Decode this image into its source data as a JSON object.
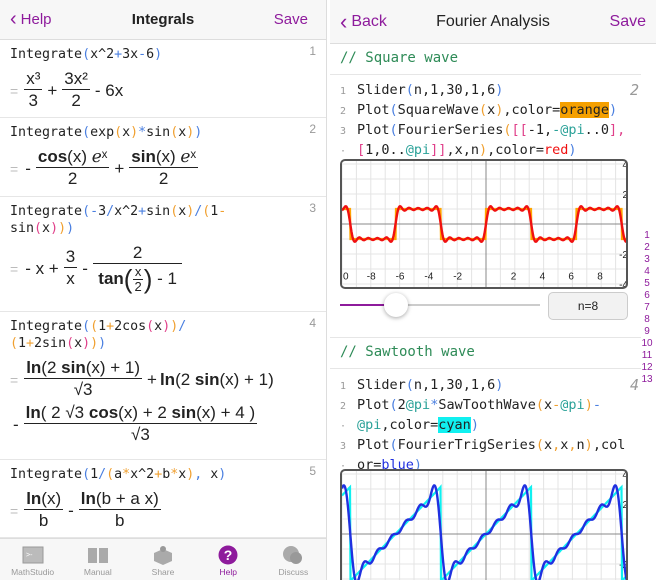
{
  "left": {
    "header": {
      "back": "Help",
      "title": "Integrals",
      "save": "Save"
    },
    "cells": [
      {
        "num": "1",
        "code": [
          [
            "Integrate",
            ""
          ],
          [
            "(",
            "b"
          ],
          [
            "x^2",
            ""
          ],
          [
            "+",
            "b"
          ],
          [
            "3x",
            ""
          ],
          [
            "-",
            "b"
          ],
          [
            "6",
            ""
          ],
          [
            ")",
            "b"
          ]
        ],
        "r": {
          "n1": "x³",
          "d1": "3",
          "op1": "+",
          "n2": "3x²",
          "d2": "2",
          "tail": "- 6x"
        }
      },
      {
        "num": "2",
        "code": [
          [
            "Integrate",
            ""
          ],
          [
            "(",
            "b"
          ],
          [
            "exp",
            ""
          ],
          [
            "(",
            "o"
          ],
          [
            "x",
            ""
          ],
          [
            ")",
            "o"
          ],
          [
            "*",
            "b"
          ],
          [
            "sin",
            ""
          ],
          [
            "(",
            "o"
          ],
          [
            "x",
            ""
          ],
          [
            ")",
            "o"
          ],
          [
            ")",
            "b"
          ]
        ],
        "r": {
          "op0": "-",
          "n1": "cos(x) ℯˣ",
          "d1": "2",
          "op1": "+",
          "n2": "sin(x) ℯˣ",
          "d2": "2"
        }
      },
      {
        "num": "3",
        "code": [
          [
            "Integrate",
            ""
          ],
          [
            "(",
            "b"
          ],
          [
            "-",
            "b"
          ],
          [
            "3",
            ""
          ],
          [
            "/",
            "b"
          ],
          [
            "x^2",
            ""
          ],
          [
            "+",
            "b"
          ],
          [
            "sin",
            ""
          ],
          [
            "(",
            "o"
          ],
          [
            "x",
            ""
          ],
          [
            ")",
            "o"
          ],
          [
            "/",
            "b"
          ],
          [
            "(",
            "o"
          ],
          [
            "1",
            ""
          ],
          [
            "-",
            "o"
          ],
          [
            "\n",
            ""
          ],
          [
            "sin",
            ""
          ],
          [
            "(",
            "p"
          ],
          [
            "x",
            ""
          ],
          [
            ")",
            "p"
          ],
          [
            ")",
            "o"
          ],
          [
            ")",
            "b"
          ]
        ],
        "r": {
          "op0": "- x +",
          "n1": "3",
          "d1": "x",
          "op1": "-",
          "n2": "2",
          "d2a": "tan",
          "lp": "(",
          "sn": "x",
          "sd": "2",
          "rp": ")",
          "d2b": "- 1"
        }
      },
      {
        "num": "4",
        "code": [
          [
            "Integrate",
            ""
          ],
          [
            "(",
            "b"
          ],
          [
            "(",
            "o"
          ],
          [
            "1",
            ""
          ],
          [
            "+",
            "o"
          ],
          [
            "2cos",
            ""
          ],
          [
            "(",
            "p"
          ],
          [
            "x",
            ""
          ],
          [
            ")",
            "p"
          ],
          [
            ")",
            "o"
          ],
          [
            "/",
            "b"
          ],
          [
            "\n",
            ""
          ],
          [
            "(",
            "o"
          ],
          [
            "1",
            ""
          ],
          [
            "+",
            "o"
          ],
          [
            "2sin",
            ""
          ],
          [
            "(",
            "p"
          ],
          [
            "x",
            ""
          ],
          [
            ")",
            "p"
          ],
          [
            ")",
            "o"
          ],
          [
            ")",
            "b"
          ]
        ],
        "r": {
          "n1": "ln(2 sin(x) + 1)",
          "d1": "√3",
          "op1": "+",
          "t1": "ln(2 sin(x) + 1)",
          "op2": "-",
          "n2": "ln( 2 √3 cos(x) + 2 sin(x) + 4 )",
          "d2": "√3"
        }
      },
      {
        "num": "5",
        "code": [
          [
            "Integrate",
            ""
          ],
          [
            "(",
            "b"
          ],
          [
            "1",
            ""
          ],
          [
            "/",
            "b"
          ],
          [
            "(",
            "o"
          ],
          [
            "a",
            ""
          ],
          [
            "*",
            "o"
          ],
          [
            "x^2",
            ""
          ],
          [
            "+",
            "o"
          ],
          [
            "b",
            ""
          ],
          [
            "*",
            "o"
          ],
          [
            "x",
            ""
          ],
          [
            ")",
            "o"
          ],
          [
            ",",
            "b"
          ],
          [
            " x",
            ""
          ],
          [
            ")",
            "b"
          ]
        ],
        "r": {
          "n1": "ln(x)",
          "d1": "b",
          "op1": "-",
          "n2": "ln(b + a x)",
          "d2": "b"
        }
      }
    ],
    "tabs": [
      {
        "label": "MathStudio",
        "icon": "terminal-icon"
      },
      {
        "label": "Manual",
        "icon": "book-icon"
      },
      {
        "label": "Share",
        "icon": "share-box-icon"
      },
      {
        "label": "Help",
        "icon": "question-icon",
        "active": true
      },
      {
        "label": "Discuss",
        "icon": "chat-bubbles-icon"
      }
    ]
  },
  "right": {
    "header": {
      "back": "Back",
      "title": "Fourier Analysis",
      "save": "Save"
    },
    "square": {
      "comment": "// Square wave",
      "num": "2",
      "lines": [
        {
          "ln": "1",
          "code": [
            [
              "Slider",
              ""
            ],
            [
              "(",
              "b"
            ],
            [
              "n,1,30,1,6",
              ""
            ],
            [
              ")",
              "b"
            ]
          ]
        },
        {
          "ln": "2",
          "code": [
            [
              "Plot",
              ""
            ],
            [
              "(",
              "b"
            ],
            [
              "SquareWave",
              ""
            ],
            [
              "(",
              "o"
            ],
            [
              "x",
              ""
            ],
            [
              ")",
              "o"
            ],
            [
              ",color=",
              ""
            ],
            [
              "orange",
              "hb"
            ],
            [
              ")",
              "b"
            ]
          ]
        },
        {
          "ln": "3",
          "code": [
            [
              "Plot",
              ""
            ],
            [
              "(",
              "b"
            ],
            [
              "FourierSeries",
              ""
            ],
            [
              "(",
              "o"
            ],
            [
              "[[",
              "p"
            ],
            [
              "-1,",
              ""
            ],
            [
              "-@pi",
              "t"
            ],
            [
              "..0",
              ""
            ],
            [
              "],",
              "p"
            ]
          ]
        },
        {
          "ln": "·",
          "code": [
            [
              "[",
              "p"
            ],
            [
              "1,0..",
              ""
            ],
            [
              "@pi",
              "t"
            ],
            [
              "]]",
              "p"
            ],
            [
              ",x,n",
              ""
            ],
            [
              ")",
              "o"
            ],
            [
              ",color=",
              ""
            ],
            [
              "red",
              "r"
            ],
            [
              ")",
              "b"
            ]
          ]
        }
      ],
      "plot": {
        "xrange": [
          -10,
          10
        ],
        "yrange": [
          -4.3,
          4.2
        ],
        "xticks": [
          "0",
          "-8",
          "-6",
          "-4",
          "-2",
          "2",
          "4",
          "6",
          "8"
        ],
        "yticks": [
          "4",
          "2",
          "-2",
          "-4"
        ],
        "series": [
          {
            "fn": "SquareWave",
            "color": "#ffa500"
          },
          {
            "fn": "FourierSeries",
            "color": "#f01010"
          }
        ]
      },
      "slider": {
        "min": 1,
        "max": 30,
        "value": 8,
        "label": "n=8"
      }
    },
    "sawtooth": {
      "comment": "// Sawtooth wave",
      "num": "4",
      "lines": [
        {
          "ln": "1",
          "code": [
            [
              "Slider",
              ""
            ],
            [
              "(",
              "b"
            ],
            [
              "n,1,30,1,6",
              ""
            ],
            [
              ")",
              "b"
            ]
          ]
        },
        {
          "ln": "2",
          "code": [
            [
              "Plot",
              ""
            ],
            [
              "(",
              "b"
            ],
            [
              "2",
              ""
            ],
            [
              "@pi",
              "t"
            ],
            [
              "*",
              "b"
            ],
            [
              "SawToothWave",
              ""
            ],
            [
              "(",
              "o"
            ],
            [
              "x",
              ""
            ],
            [
              "-",
              "o"
            ],
            [
              "@pi",
              "t"
            ],
            [
              ")",
              "o"
            ],
            [
              "-",
              "b"
            ]
          ]
        },
        {
          "ln": "·",
          "code": [
            [
              "@pi",
              "t"
            ],
            [
              ",color=",
              ""
            ],
            [
              "cyan",
              "hc"
            ],
            [
              ")",
              "b"
            ]
          ]
        },
        {
          "ln": "3",
          "code": [
            [
              "Plot",
              ""
            ],
            [
              "(",
              "b"
            ],
            [
              "FourierTrigSeries",
              ""
            ],
            [
              "(",
              "o"
            ],
            [
              "x",
              ""
            ],
            [
              ",",
              "o"
            ],
            [
              "x",
              ""
            ],
            [
              ",",
              "o"
            ],
            [
              "n",
              ""
            ],
            [
              ")",
              "o"
            ],
            [
              ",col",
              ""
            ]
          ]
        },
        {
          "ln": "·",
          "code": [
            [
              "or=",
              ""
            ],
            [
              "blue",
              "bl"
            ],
            [
              ")",
              "b"
            ]
          ]
        }
      ],
      "plot": {
        "xrange": [
          -10,
          10
        ],
        "yrange": [
          -4.3,
          4.2
        ],
        "yticks": [
          "4",
          "2",
          "-2"
        ],
        "series": [
          {
            "fn": "SawToothWave",
            "color": "#10f0f0"
          },
          {
            "fn": "FourierTrigSeries",
            "color": "#2030e0"
          }
        ]
      }
    },
    "index": [
      "1",
      "2",
      "3",
      "4",
      "5",
      "6",
      "7",
      "8",
      "9",
      "10",
      "11",
      "12",
      "13"
    ]
  },
  "colors": {
    "accent": "#8e1b9c"
  }
}
